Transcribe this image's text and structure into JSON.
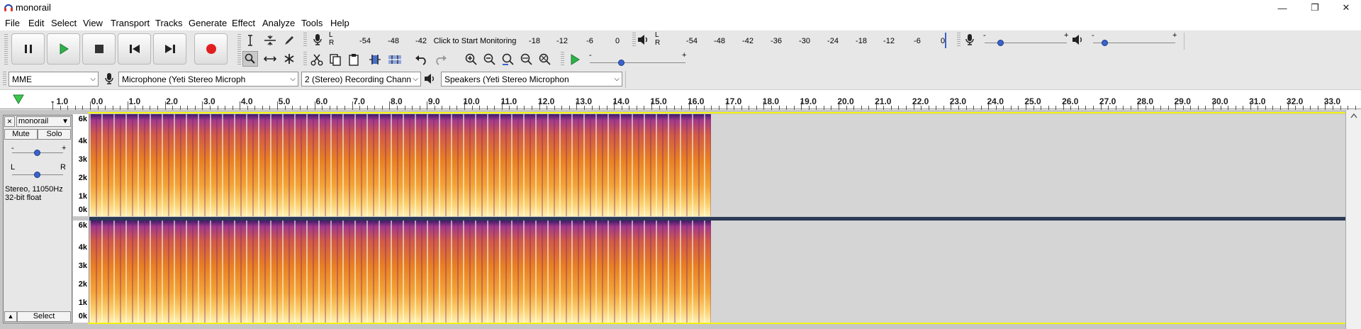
{
  "window": {
    "title": "monorail",
    "minimize_glyph": "—",
    "maximize_glyph": "❐",
    "close_glyph": "✕"
  },
  "menu": [
    "File",
    "Edit",
    "Select",
    "View",
    "Transport",
    "Tracks",
    "Generate",
    "Effect",
    "Analyze",
    "Tools",
    "Help"
  ],
  "transport": {
    "pause_icon": "pause-icon",
    "play_icon": "play-icon",
    "stop_icon": "stop-icon",
    "skip_start_icon": "skip-to-start-icon",
    "skip_end_icon": "skip-to-end-icon",
    "record_icon": "record-icon"
  },
  "recording_meter": {
    "channels": "L\nR",
    "ticks": [
      "-54",
      "-48",
      "-42",
      "-18",
      "-12",
      "-6",
      "0"
    ],
    "prompt": "Click to Start Monitoring"
  },
  "playback_meter": {
    "channels": "L\nR",
    "ticks": [
      "-54",
      "-48",
      "-42",
      "-36",
      "-30",
      "-24",
      "-18",
      "-12",
      "-6",
      "0"
    ]
  },
  "mixer": {
    "minus": "-",
    "plus": "+",
    "record_volume_level": 0.2,
    "playback_volume_level": 0.15
  },
  "play_at_speed": {
    "minus": "-",
    "plus": "+",
    "level": 0.33
  },
  "devices": {
    "host": "MME",
    "recording_device": "Microphone (Yeti Stereo Microph",
    "channels": "2 (Stereo) Recording Chann",
    "playback_device": "Speakers (Yeti Stereo Microphon",
    "dropdown_glyph": "⌵"
  },
  "timeline": {
    "ticks": [
      "- 1.0",
      "0.0",
      "1.0",
      "2.0",
      "3.0",
      "4.0",
      "5.0",
      "6.0",
      "7.0",
      "8.0",
      "9.0",
      "10.0",
      "11.0",
      "12.0",
      "13.0",
      "14.0",
      "15.0",
      "16.0",
      "17.0",
      "18.0",
      "19.0",
      "20.0",
      "21.0",
      "22.0",
      "23.0",
      "24.0",
      "25.0",
      "26.0",
      "27.0",
      "28.0",
      "29.0",
      "30.0",
      "31.0",
      "32.0",
      "33.0"
    ]
  },
  "track": {
    "close": "×",
    "name": "monorail",
    "menu_arrow": "▼",
    "mute": "Mute",
    "solo": "Solo",
    "gain_minus": "-",
    "gain_plus": "+",
    "pan_left": "L",
    "pan_right": "R",
    "format_line1": "Stereo, 11050Hz",
    "format_line2": "32-bit float",
    "collapse": "▲",
    "select": "Select",
    "freq_labels": [
      "6k",
      "4k",
      "3k",
      "2k",
      "1k",
      "0k"
    ],
    "audio_end_seconds": 16.6
  },
  "colors": {
    "accent_blue": "#3a64cc",
    "record_red": "#e02020",
    "play_green": "#2db24a",
    "selection_yellow": "#f3f310"
  }
}
